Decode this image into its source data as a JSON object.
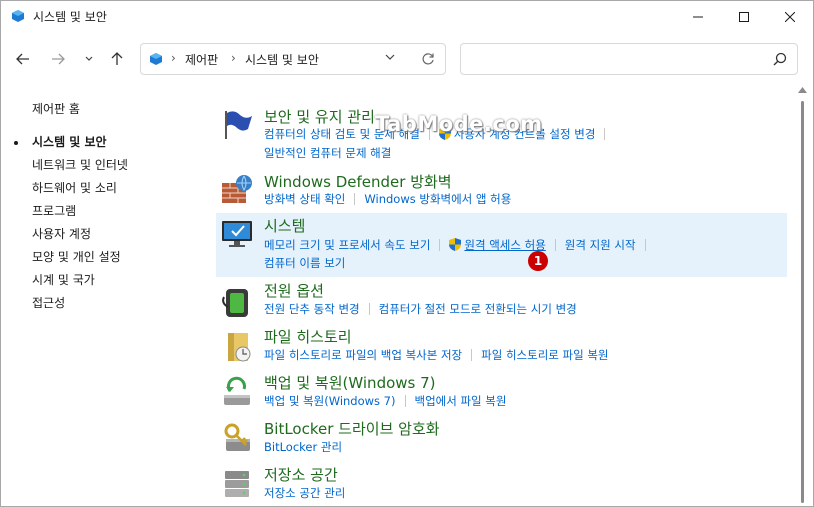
{
  "window": {
    "title": "시스템 및 보안",
    "minimize_icon": "minimize-icon",
    "maximize_icon": "maximize-icon",
    "close_icon": "close-icon"
  },
  "nav": {
    "back_icon": "back-arrow-icon",
    "forward_icon": "forward-arrow-icon",
    "recent_icon": "chevron-down-icon",
    "up_icon": "up-arrow-icon"
  },
  "address": {
    "sep1": "›",
    "crumb1": "제어판",
    "sep2": "›",
    "crumb2": "시스템 및 보안"
  },
  "search": {
    "placeholder": ""
  },
  "sidebar": {
    "home": "제어판 홈",
    "items": [
      {
        "label": "시스템 및 보안",
        "current": true
      },
      {
        "label": "네트워크 및 인터넷"
      },
      {
        "label": "하드웨어 및 소리"
      },
      {
        "label": "프로그램"
      },
      {
        "label": "사용자 계정"
      },
      {
        "label": "모양 및 개인 설정"
      },
      {
        "label": "시계 및 국가"
      },
      {
        "label": "접근성"
      }
    ]
  },
  "watermark": "TabMode.com",
  "badge": "1",
  "categories": [
    {
      "title": "보안 및 유지 관리",
      "rows": [
        [
          "컴퓨터의 상태 검토 및 문제 해결",
          "사용자 계정 컨트롤 설정 변경"
        ],
        [
          "일반적인 컴퓨터 문제 해결"
        ]
      ]
    },
    {
      "title": "Windows Defender 방화벽",
      "rows": [
        [
          "방화벽 상태 확인",
          "Windows 방화벽에서 앱 허용"
        ]
      ]
    },
    {
      "title": "시스템",
      "rows": [
        [
          "메모리 크기 및 프로세서 속도 보기",
          "원격 액세스 허용",
          "원격 지원 시작"
        ],
        [
          "컴퓨터 이름 보기"
        ]
      ]
    },
    {
      "title": "전원 옵션",
      "rows": [
        [
          "전원 단추 동작 변경",
          "컴퓨터가 절전 모드로 전환되는 시기 변경"
        ]
      ]
    },
    {
      "title": "파일 히스토리",
      "rows": [
        [
          "파일 히스토리로 파일의 백업 복사본 저장",
          "파일 히스토리로 파일 복원"
        ]
      ]
    },
    {
      "title": "백업 및 복원(Windows 7)",
      "rows": [
        [
          "백업 및 복원(Windows 7)",
          "백업에서 파일 복원"
        ]
      ]
    },
    {
      "title": "BitLocker 드라이브 암호화",
      "rows": [
        [
          "BitLocker 관리"
        ]
      ]
    },
    {
      "title": "저장소 공간",
      "rows": [
        [
          "저장소 공간 관리"
        ]
      ]
    }
  ]
}
